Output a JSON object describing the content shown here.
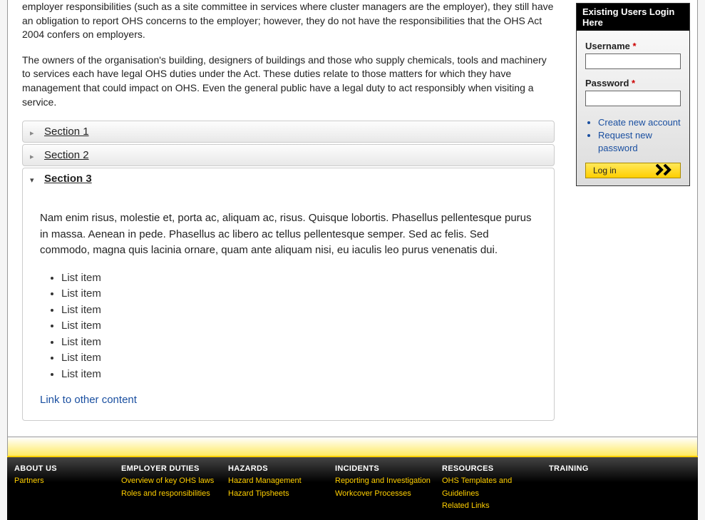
{
  "main": {
    "para1": "employer responsibilities (such as a site committee in services where cluster managers are the employer), they still have an obligation to report OHS concerns to the employer; however, they do not have the responsibilities that the OHS Act 2004 confers on employers.",
    "para2": "The owners of the organisation's building, designers of buildings and those who supply chemicals, tools and machinery to services each have legal OHS duties under the Act. These duties relate to those matters for which they have management that could impact on OHS. Even the general public have a legal duty to act responsibly when visiting a service.",
    "sections": [
      {
        "title": "Section 1"
      },
      {
        "title": "Section 2"
      },
      {
        "title": "Section 3"
      }
    ],
    "section3": {
      "para": "Nam enim risus, molestie et, porta ac, aliquam ac, risus. Quisque lobortis. Phasellus pellentesque purus in massa. Aenean in pede. Phasellus ac libero ac tellus pellentesque semper. Sed ac felis. Sed commodo, magna quis lacinia ornare, quam ante aliquam nisi, eu iaculis leo purus venenatis dui.",
      "items": [
        "List item",
        "List item",
        "List item",
        "List item",
        "List item",
        "List item",
        "List item"
      ],
      "link": "Link to other content"
    }
  },
  "login": {
    "title": "Existing Users Login Here",
    "username_label": "Username",
    "password_label": "Password",
    "required": "*",
    "links": [
      "Create new account",
      "Request new password"
    ],
    "button": "Log in"
  },
  "footer": {
    "cols": [
      {
        "heading": "ABOUT US",
        "links": [
          "Partners"
        ]
      },
      {
        "heading": "EMPLOYER DUTIES",
        "links": [
          "Overview of key OHS laws",
          "Roles and responsibilities"
        ]
      },
      {
        "heading": "HAZARDS",
        "links": [
          "Hazard Management",
          "Hazard Tipsheets"
        ]
      },
      {
        "heading": "INCIDENTS",
        "links": [
          "Reporting and Investigation",
          "Workcover Processes"
        ]
      },
      {
        "heading": "RESOURCES",
        "links": [
          "OHS Templates and Guidelines",
          "Related Links"
        ]
      },
      {
        "heading": "TRAINING",
        "links": []
      }
    ]
  }
}
